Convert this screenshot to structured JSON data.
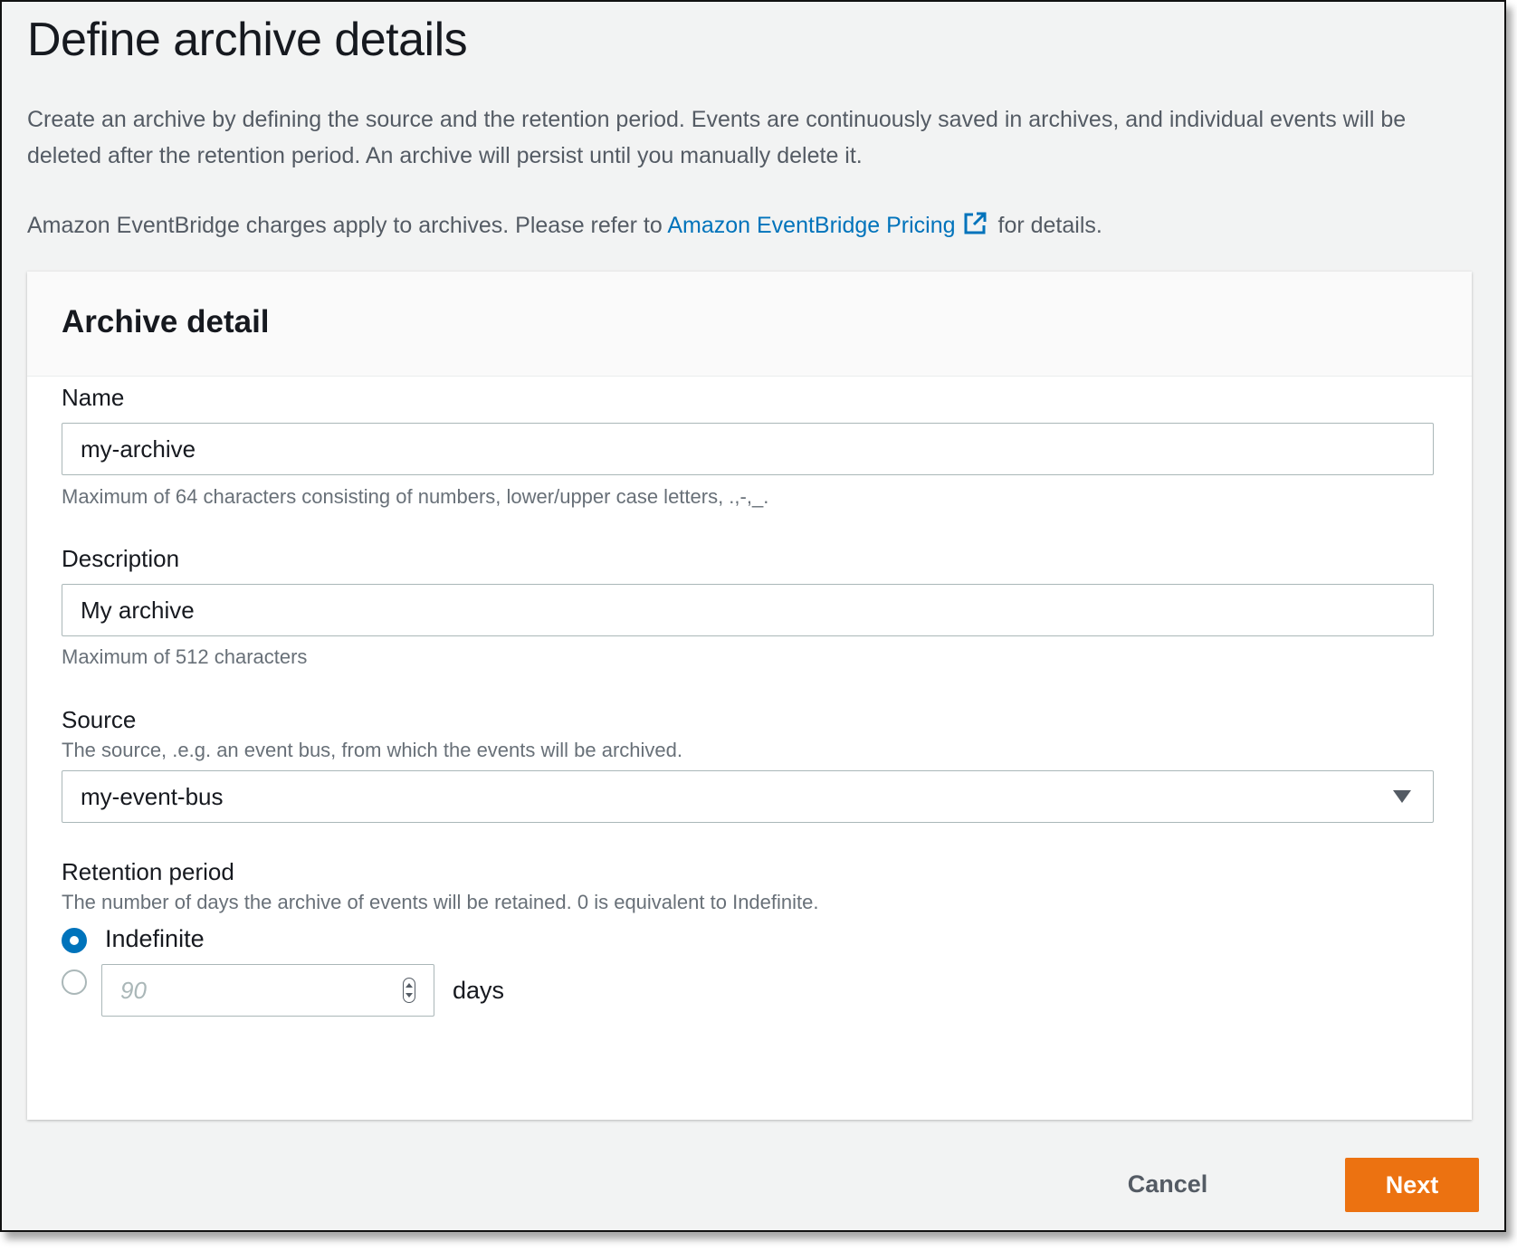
{
  "page": {
    "title": "Define archive details",
    "intro": "Create an archive by defining the source and the retention period. Events are continuously saved in archives, and individual events will be deleted after the retention period. An archive will persist until you manually delete it.",
    "pricing_prefix": "Amazon EventBridge charges apply to archives. Please refer to ",
    "pricing_link": "Amazon EventBridge Pricing",
    "pricing_suffix": " for details."
  },
  "panel": {
    "title": "Archive detail",
    "name": {
      "label": "Name",
      "value": "my-archive",
      "hint": "Maximum of 64 characters consisting of numbers, lower/upper case letters, .,-,_."
    },
    "description": {
      "label": "Description",
      "value": "My archive",
      "hint": "Maximum of 512 characters"
    },
    "source": {
      "label": "Source",
      "hint": "The source, .e.g. an event bus, from which the events will be archived.",
      "selected": "my-event-bus"
    },
    "retention": {
      "label": "Retention period",
      "hint": "The number of days the archive of events will be retained. 0 is equivalent to Indefinite.",
      "option_indefinite": "Indefinite",
      "days_placeholder": "90",
      "days_label": "days"
    }
  },
  "actions": {
    "cancel": "Cancel",
    "next": "Next"
  },
  "colors": {
    "link": "#0073bb",
    "primary_button": "#ec7211",
    "radio_selected": "#0073bb"
  },
  "icons": {
    "external_link": "external-link-icon",
    "select_caret": "caret-down-icon",
    "spinner": "number-spinner-icon"
  }
}
